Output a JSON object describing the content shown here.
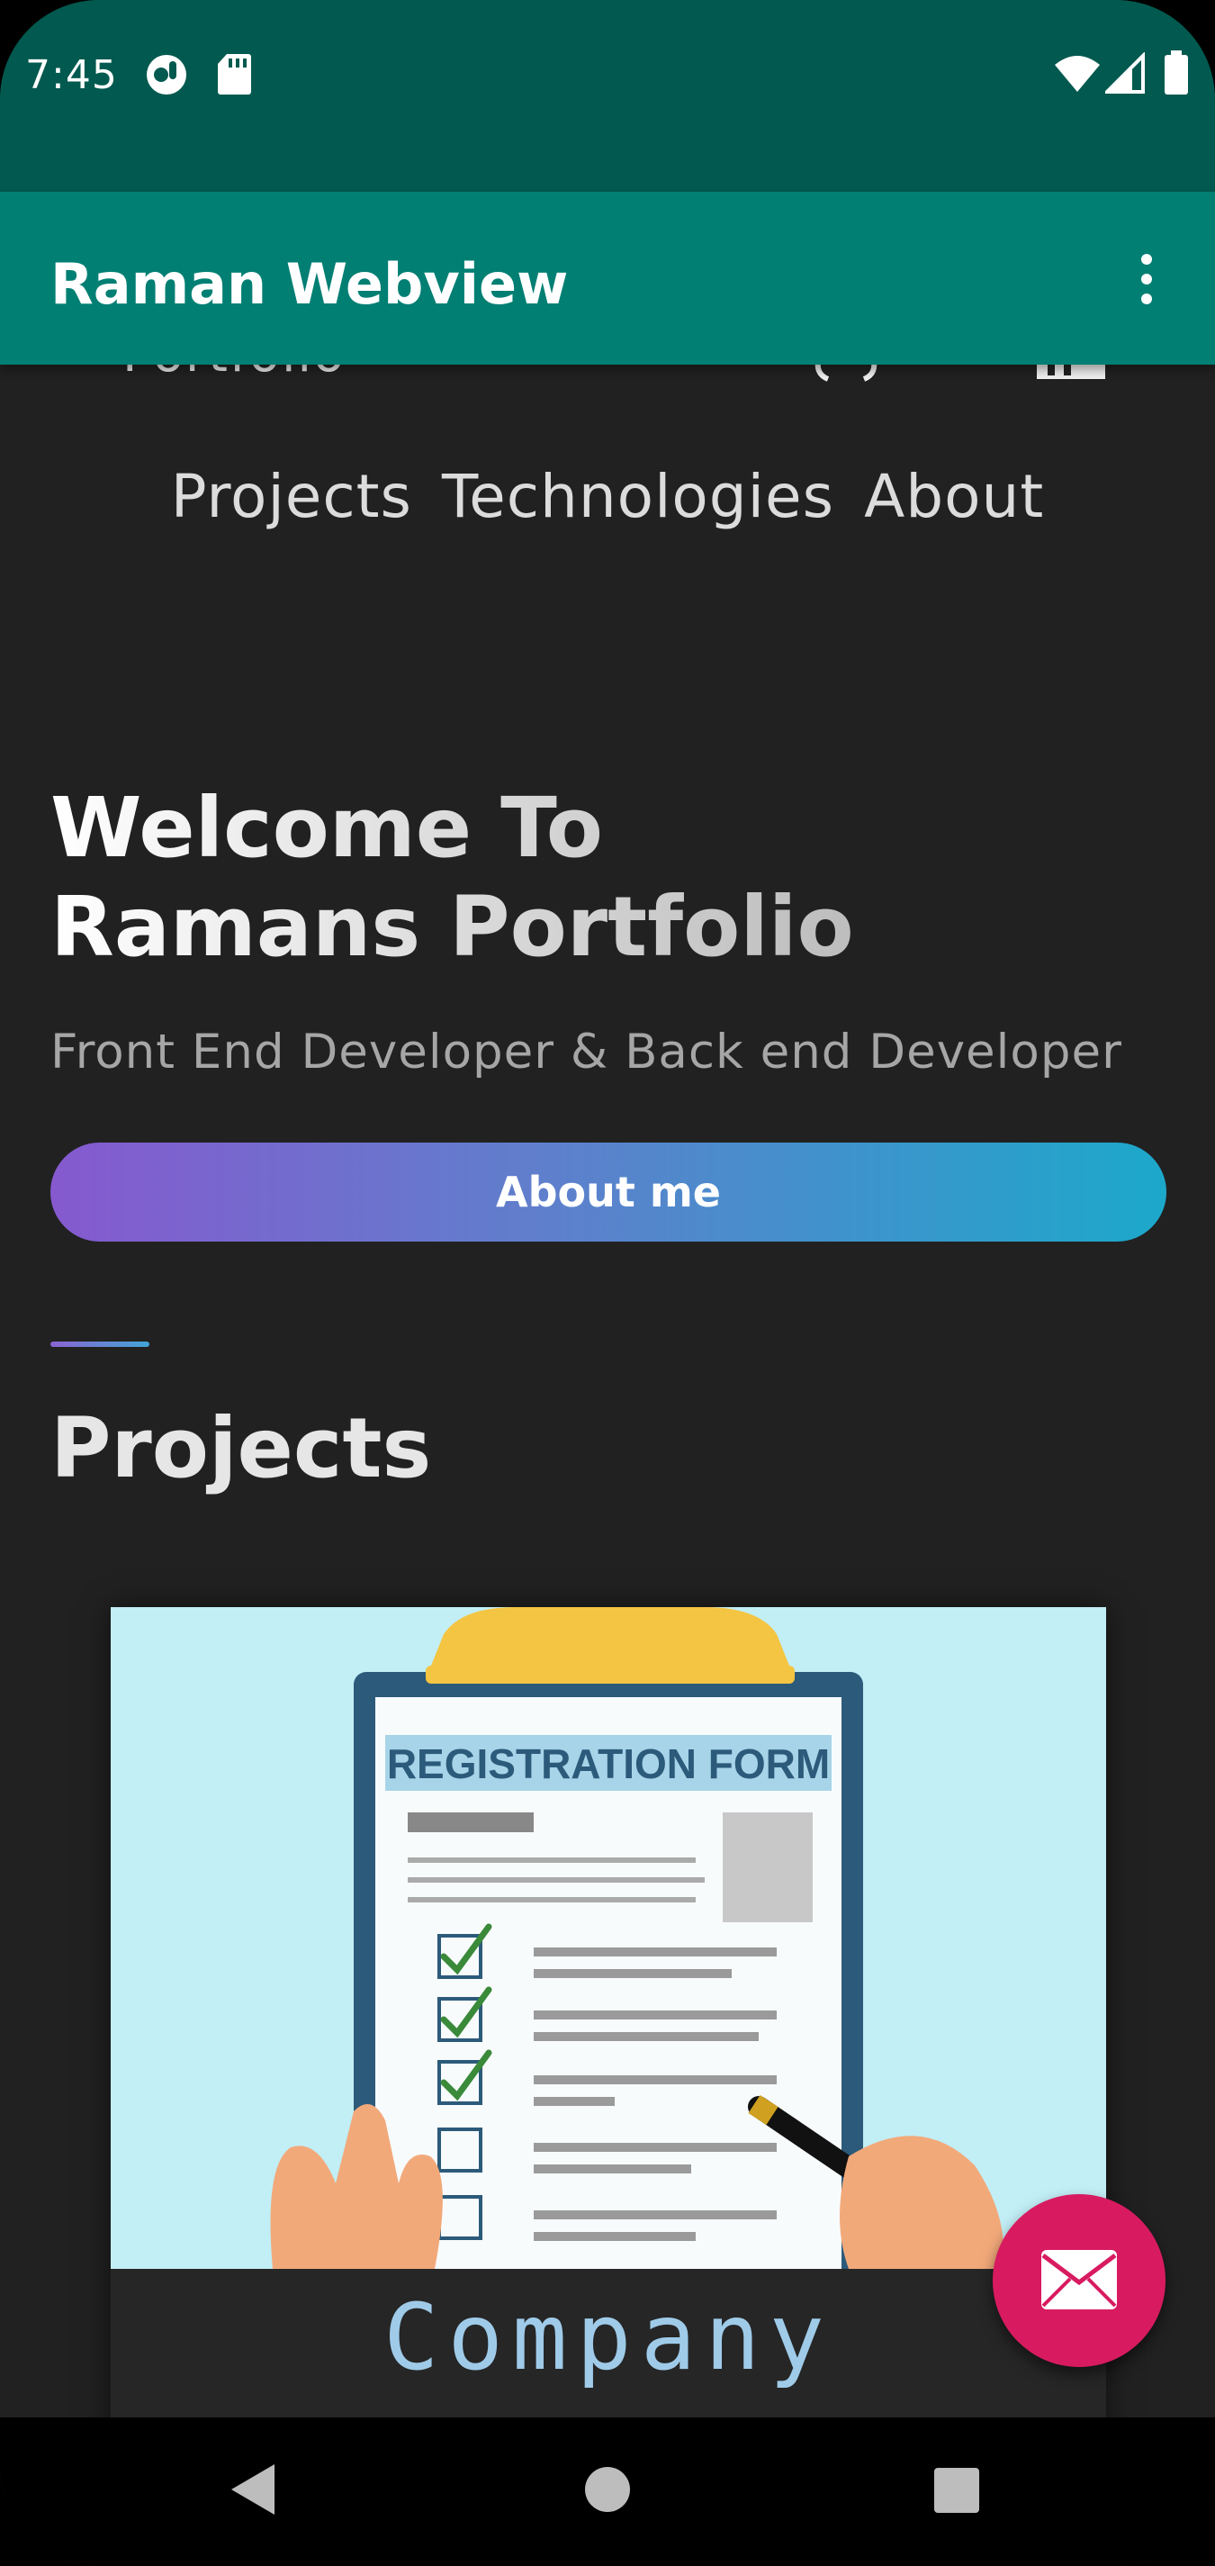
{
  "status_bar": {
    "time": "7:45",
    "left_icons": [
      "assistant-icon",
      "sd-card-icon"
    ],
    "right_icons": [
      "wifi-icon",
      "signal-icon",
      "battery-icon"
    ]
  },
  "app_bar": {
    "title": "Raman Webview",
    "menu_icon": "more-vert-icon"
  },
  "webview": {
    "clipped_header_text": "Portfolio",
    "nav_links": [
      "Projects",
      "Technologies",
      "About"
    ],
    "hero": {
      "title_line1": "Welcome To",
      "title_line2": "Ramans Portfolio",
      "subtitle": "Front End Developer & Back end Developer",
      "button_label": "About me"
    },
    "projects": {
      "heading": "Projects",
      "cards": [
        {
          "image_caption": "REGISTRATION FORM",
          "title": "Company"
        }
      ]
    },
    "fab_icon": "mail-icon"
  },
  "nav_bar": {
    "buttons": [
      "back-icon",
      "home-icon",
      "recents-icon"
    ]
  },
  "colors": {
    "status_bar": "#01594f",
    "app_bar": "#027f73",
    "page_background": "#212121",
    "fab": "#d81b60",
    "button_gradient_start": "#8659cf",
    "button_gradient_end": "#1ca8cb",
    "card_title": "#9fcbe9"
  }
}
